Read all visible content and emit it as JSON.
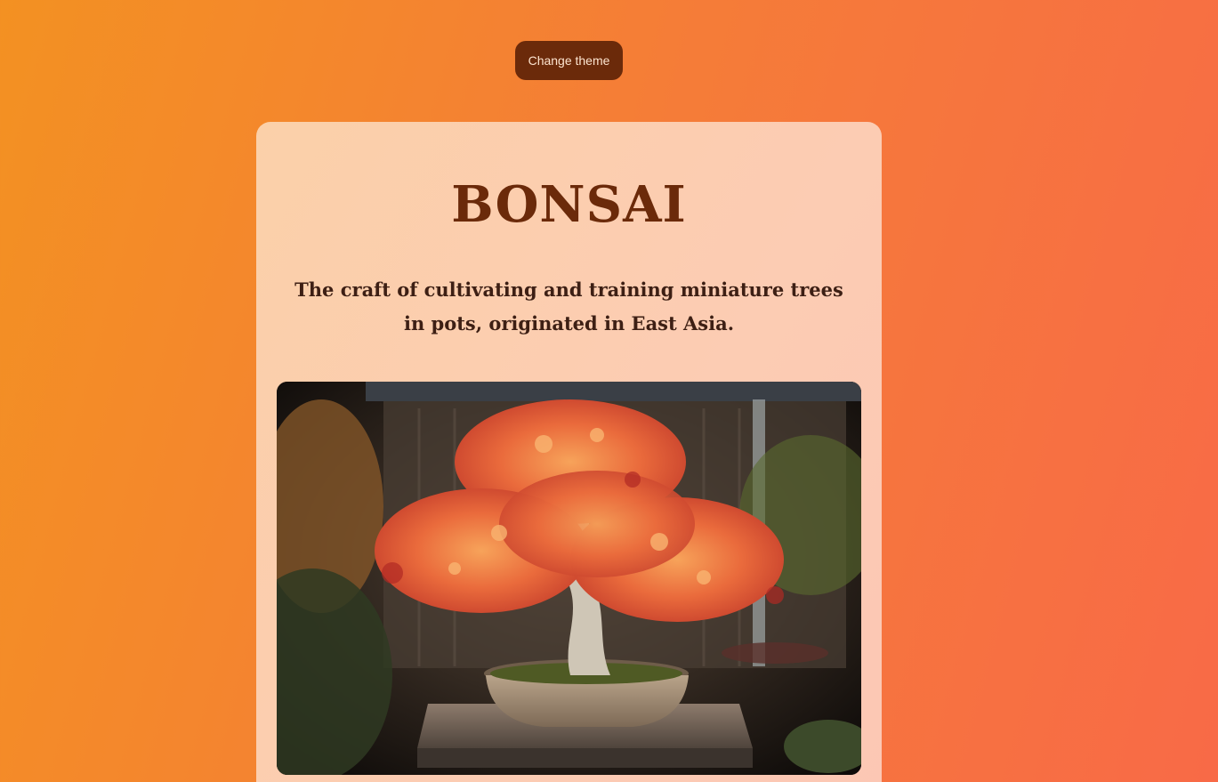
{
  "controls": {
    "theme_button_label": "Change theme"
  },
  "hero": {
    "title": "BONSAI",
    "subtitle": "The craft of cultivating and training miniature trees in pots, originated in East Asia."
  },
  "colors": {
    "accent": "#6b2a0a",
    "background_start": "#f39122",
    "background_end": "#f86a47",
    "card": "#fbd0a9"
  }
}
